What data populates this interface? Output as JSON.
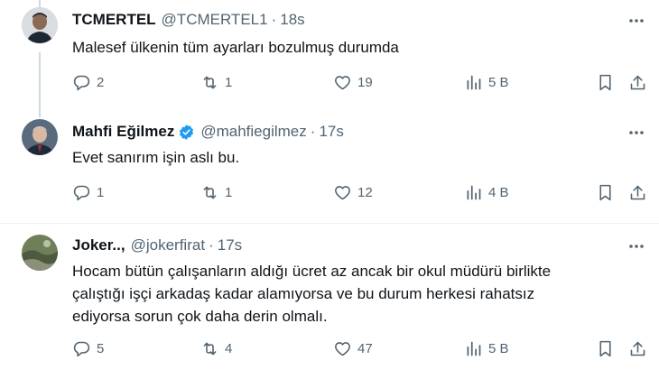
{
  "tweets": [
    {
      "name": "TCMERTEL",
      "handle": "@TCMERTEL1",
      "time": "18s",
      "verified": false,
      "text": "Malesef ülkenin tüm ayarları bozulmuş durumda",
      "stats": {
        "replies": "2",
        "retweets": "1",
        "likes": "19",
        "views": "5 B"
      }
    },
    {
      "name": "Mahfi Eğilmez",
      "handle": "@mahfiegilmez",
      "time": "17s",
      "verified": true,
      "text": "Evet sanırım işin aslı bu.",
      "stats": {
        "replies": "1",
        "retweets": "1",
        "likes": "12",
        "views": "4 B"
      }
    },
    {
      "name": "Joker..,",
      "handle": "@jokerfirat",
      "time": "17s",
      "verified": false,
      "text": "Hocam bütün çalışanların aldığı ücret az ancak bir okul müdürü birlikte\nçalıştığı işçi arkadaş kadar alamıyorsa ve bu durum herkesi rahatsız\nediyorsa sorun çok daha derin olmalı.",
      "stats": {
        "replies": "5",
        "retweets": "4",
        "likes": "47",
        "views": "5 B"
      }
    }
  ],
  "colors": {
    "text_primary": "#0f1419",
    "text_secondary": "#536471",
    "verified_blue": "#1d9bf0",
    "thread_line": "#cfd9de"
  },
  "icons": [
    "reply-icon",
    "retweet-icon",
    "like-icon",
    "views-icon",
    "bookmark-icon",
    "share-icon",
    "more-icon",
    "verified-badge-icon"
  ]
}
